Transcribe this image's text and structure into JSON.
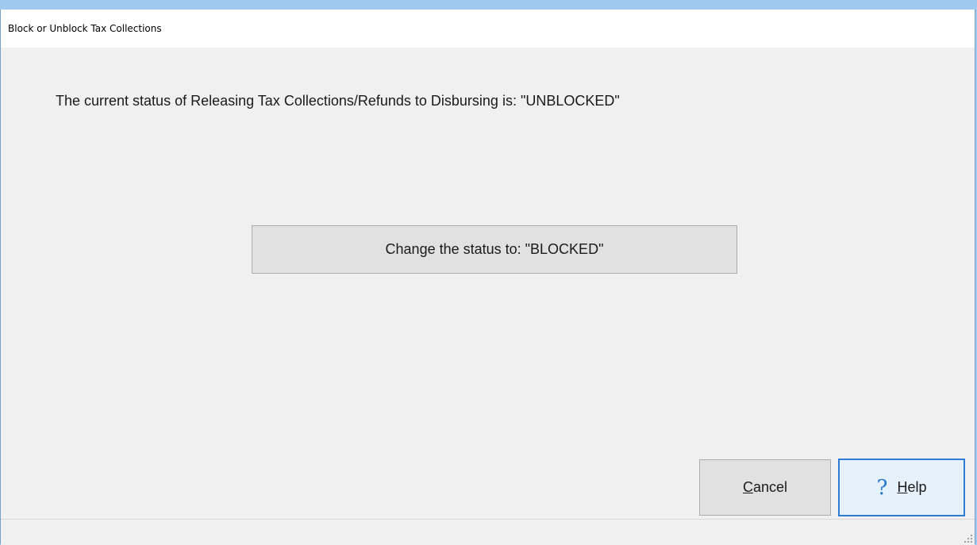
{
  "window": {
    "title": "Block or Unblock Tax Collections"
  },
  "main": {
    "status_message": "The current status of Releasing Tax Collections/Refunds to Disbursing is: \"UNBLOCKED\"",
    "change_button_label": "Change the status to: \"BLOCKED\""
  },
  "buttons": {
    "cancel": {
      "mnemonic": "C",
      "rest": "ancel"
    },
    "help": {
      "icon": "question-mark-icon",
      "mnemonic": "H",
      "rest": "elp"
    }
  },
  "colors": {
    "desktop": "#9fc9ee",
    "window_bg": "#f0f0f0",
    "focus_border": "#2f7bd1",
    "help_icon": "#2a78d0"
  }
}
